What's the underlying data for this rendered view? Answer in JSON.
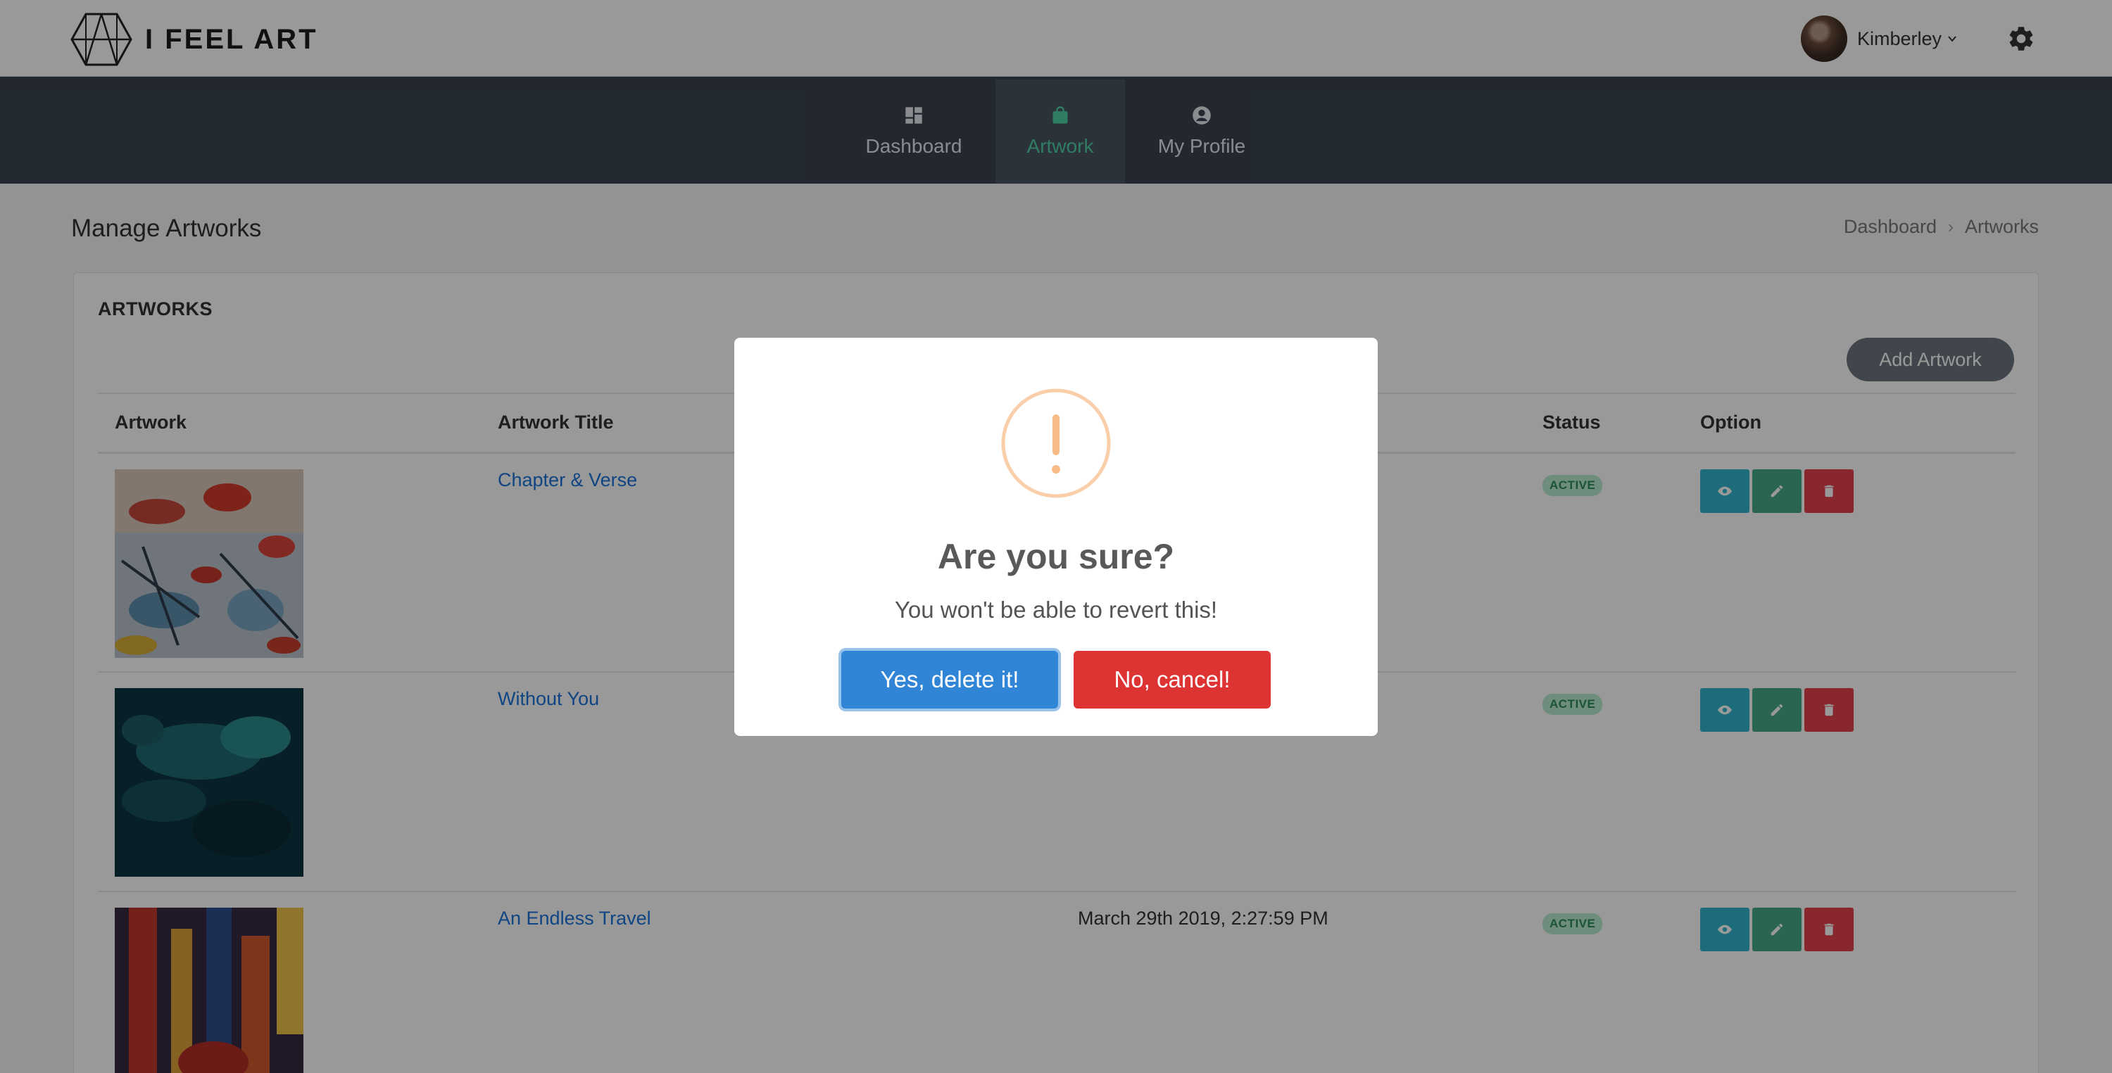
{
  "brand": {
    "name": "I FEEL ART",
    "icon": "geometric-logo-icon"
  },
  "user": {
    "name": "Kimberley",
    "icons": [
      "avatar",
      "chevron-down-icon",
      "gear-icon"
    ]
  },
  "nav": {
    "items": [
      {
        "label": "Dashboard",
        "icon": "dashboard-icon",
        "active": false
      },
      {
        "label": "Artwork",
        "icon": "shopping-bag-icon",
        "active": true
      },
      {
        "label": "My Profile",
        "icon": "user-circle-icon",
        "active": false
      }
    ],
    "active_color": "#4fd1a5"
  },
  "page": {
    "title": "Manage Artworks",
    "breadcrumb": [
      "Dashboard",
      "Artworks"
    ]
  },
  "card": {
    "title": "ARTWORKS",
    "add_button": "Add Artwork",
    "columns": [
      "Artwork",
      "Artwork Title",
      "",
      "Status",
      "Option"
    ],
    "rows": [
      {
        "title": "Chapter & Verse",
        "date": "",
        "status": "ACTIVE"
      },
      {
        "title": "Without You",
        "date": "",
        "status": "ACTIVE"
      },
      {
        "title": "An Endless Travel",
        "date": "March 29th 2019, 2:27:59 PM",
        "status": "ACTIVE"
      }
    ],
    "option_icons": [
      "eye-icon",
      "pencil-icon",
      "trash-icon"
    ]
  },
  "modal": {
    "icon": "warning-icon",
    "title": "Are you sure?",
    "text": "You won't be able to revert this!",
    "confirm": "Yes, delete it!",
    "cancel": "No, cancel!",
    "colors": {
      "confirm": "#3085d6",
      "cancel": "#dd3333",
      "warning": "#f8bb86"
    }
  }
}
